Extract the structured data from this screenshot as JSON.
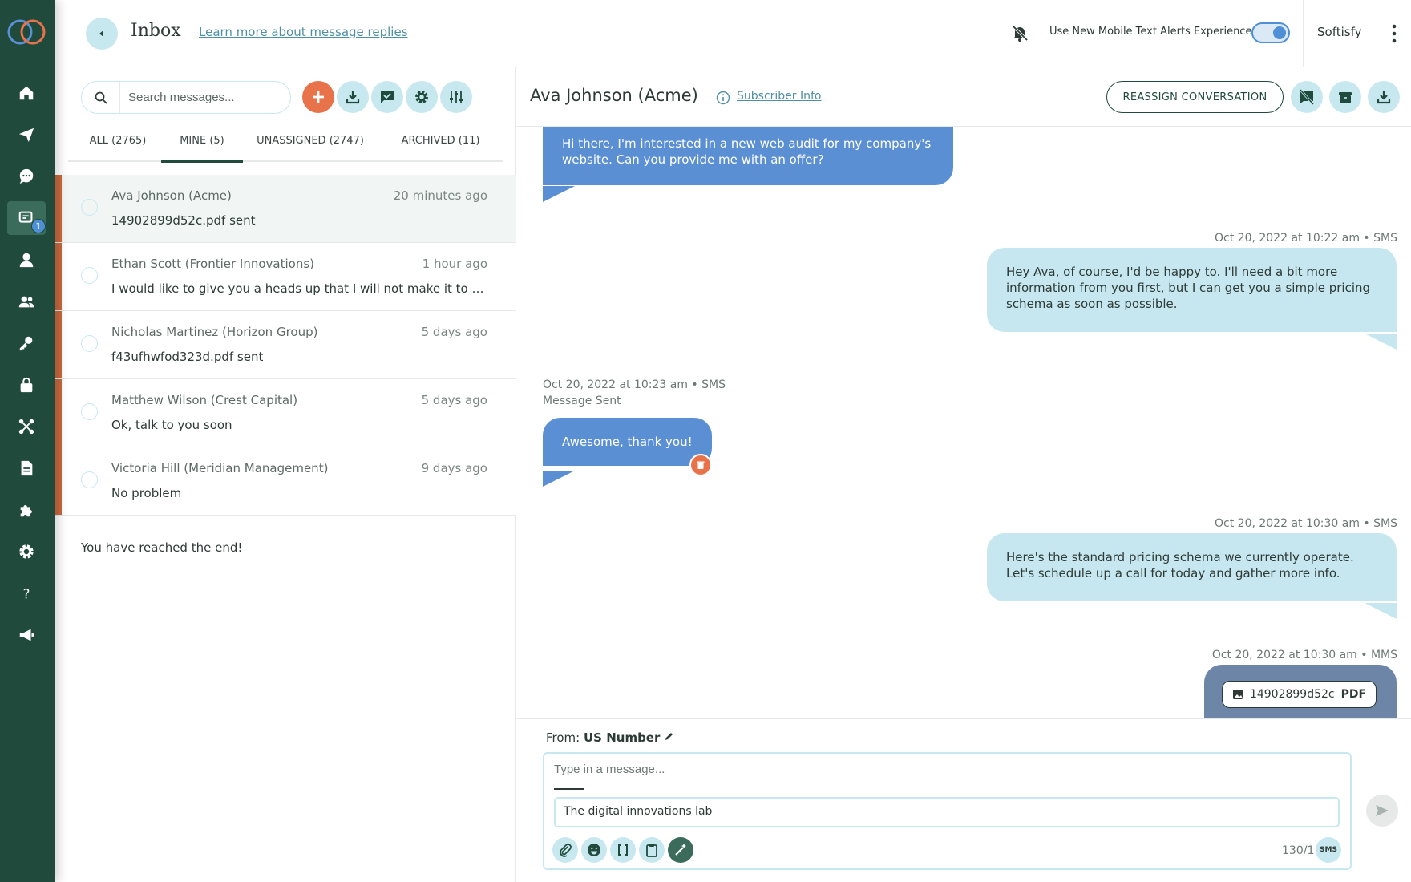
{
  "header": {
    "title": "Inbox",
    "learn_link": "Learn more about message replies",
    "toggle_label": "Use New Mobile Text Alerts Experience",
    "org_name": "Softisfy"
  },
  "sidebar": {
    "badge": "1",
    "items": [
      "home-icon",
      "send-icon",
      "chat-icon",
      "inbox-icon",
      "user-icon",
      "group-icon",
      "key-icon",
      "lock-icon",
      "share-icon",
      "document-icon",
      "puzzle-icon",
      "gear-icon",
      "help-icon",
      "megaphone-icon"
    ]
  },
  "list": {
    "search_placeholder": "Search messages...",
    "tabs": [
      {
        "label": "ALL  (2765)"
      },
      {
        "label": "MINE  (5)"
      },
      {
        "label": "UNASSIGNED  (2747)"
      },
      {
        "label": "ARCHIVED  (11)"
      }
    ],
    "conversations": [
      {
        "name": "Ava Johnson (Acme)",
        "time": "20 minutes ago",
        "preview": "14902899d52c.pdf sent"
      },
      {
        "name": "Ethan Scott (Frontier Innovations)",
        "time": "1 hour ago",
        "preview": "I would like to give you a heads up that I will not make it to our ..."
      },
      {
        "name": "Nicholas Martinez (Horizon Group)",
        "time": "5 days ago",
        "preview": "f43ufhwfod323d.pdf sent"
      },
      {
        "name": "Matthew Wilson (Crest Capital)",
        "time": "5 days ago",
        "preview": "Ok, talk to you soon"
      },
      {
        "name": "Victoria Hill (Meridian Management)",
        "time": "9 days ago",
        "preview": "No problem"
      }
    ],
    "end_message": "You have reached the end!"
  },
  "chat": {
    "contact": "Ava Johnson (Acme)",
    "subscriber_link": "Subscriber Info",
    "reassign_label": "REASSIGN CONVERSATION",
    "messages": [
      {
        "text": "Hi there, I'm interested in a new web audit for my company's website. Can you provide me with an offer?"
      },
      {
        "meta": "Oct 20, 2022 at 10:22 am  •  SMS",
        "text": "Hey Ava, of course, I'd be happy to. I'll need a bit more information from you first, but I can get you a simple pricing schema as soon as possible."
      },
      {
        "meta": "Oct 20, 2022 at 10:23 am  •  SMS",
        "status": "Message Sent",
        "text": "Awesome, thank you!"
      },
      {
        "meta": "Oct 20, 2022 at 10:30 am  •  SMS",
        "text": "Here's the standard pricing schema we currently operate. Let's schedule up a call for today and gather more info."
      },
      {
        "meta": "Oct 20, 2022 at 10:30 am  •  MMS",
        "file": "14902899d52c",
        "file_type": "PDF"
      }
    ]
  },
  "composer": {
    "from_label": "From:",
    "from_value": "US Number",
    "placeholder": "Type in a message...",
    "signature": "The digital innovations lab",
    "char_count": "130/1",
    "channel": "SMS"
  }
}
